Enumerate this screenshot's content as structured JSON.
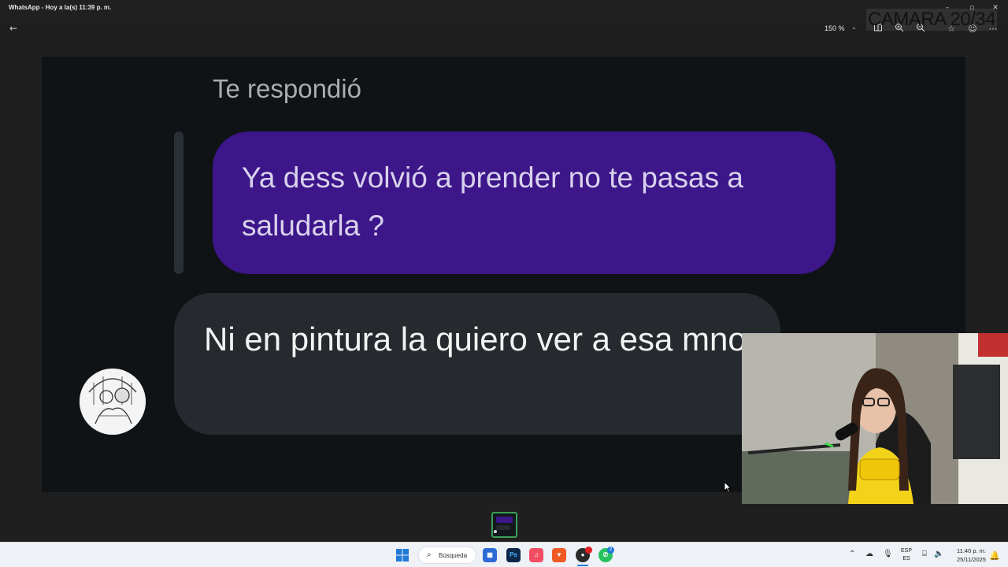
{
  "window": {
    "title": "WhatsApp - Hoy a la(s) 11:39 p. m.",
    "controls": {
      "minimize": "–",
      "maximize": "▫",
      "close": "✕"
    }
  },
  "toolbar": {
    "back_icon": "arrow-left-icon",
    "zoom_level": "150 %",
    "icons": [
      "crop-icon",
      "zoom-in-icon",
      "zoom-out-icon",
      "favorite-star-icon",
      "emoji-icon",
      "more-icon"
    ]
  },
  "stream_overlay": {
    "text": "CAMARA 20/34"
  },
  "chat": {
    "reply_label": "Te respondió",
    "quoted_message": "Ya dess volvió a prender no te pasas a saludarla ?",
    "received_message": "Ni en pintura la quiero ver a esa mno",
    "colors": {
      "quoted_bubble": "#3d168a",
      "received_bubble": "#262a2f",
      "background": "#0f1316"
    }
  },
  "taskbar": {
    "search_placeholder": "Búsqueda",
    "apps": [
      "windows-start-icon",
      "store-icon",
      "photoshop-icon",
      "music-icon",
      "brave-icon",
      "obs-icon",
      "whatsapp-icon"
    ],
    "photoshop_label": "Ps",
    "whatsapp_badge": "2",
    "language_top": "ESP",
    "language_bottom": "ES",
    "time": "11:40 p. m.",
    "date": "25/11/2025"
  }
}
